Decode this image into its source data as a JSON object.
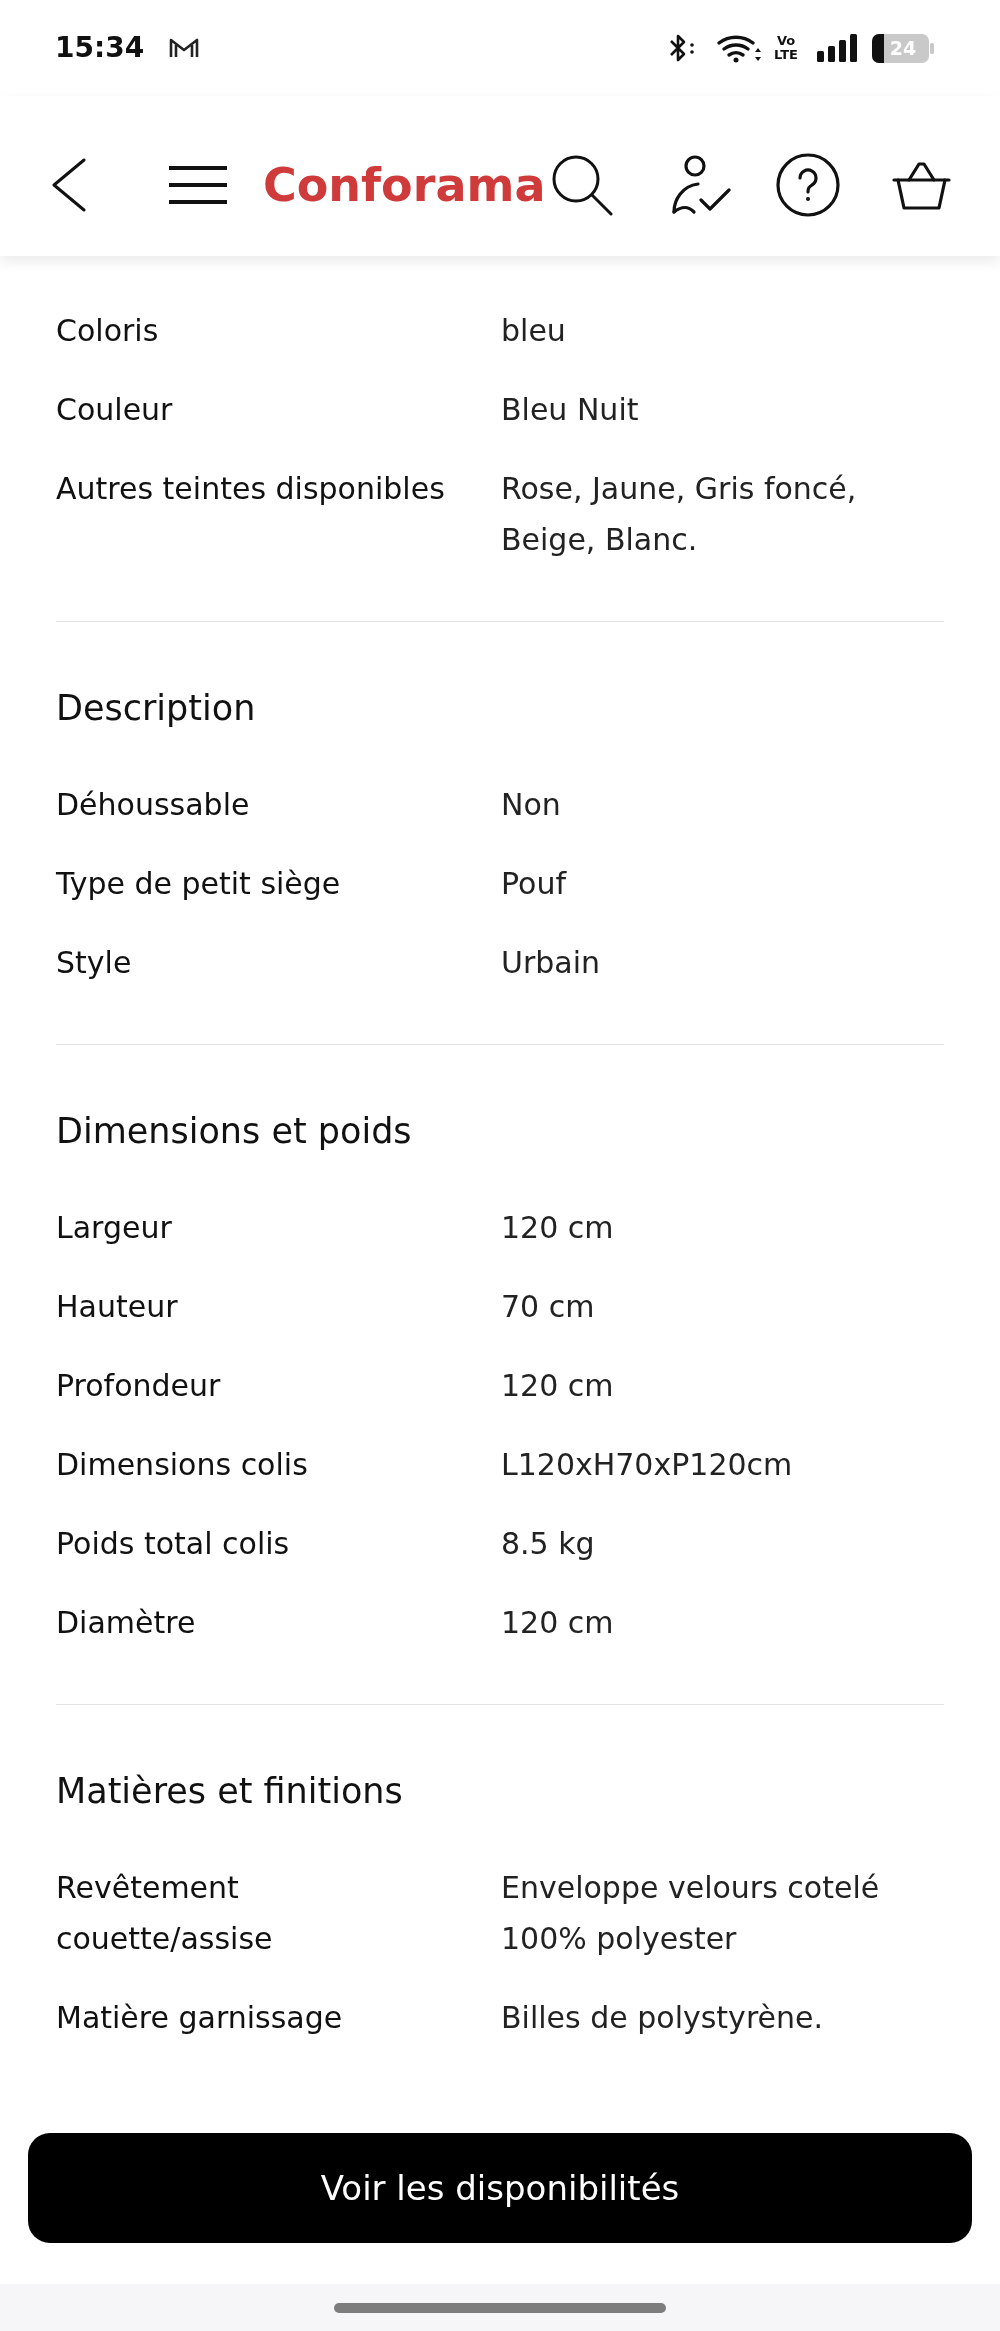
{
  "status_bar": {
    "time": "15:34",
    "network_label": [
      "Vo",
      "LTE"
    ],
    "battery": "24"
  },
  "header": {
    "logo": "Conforama"
  },
  "sections": [
    {
      "rows": [
        {
          "label": "Coloris",
          "value": "bleu"
        },
        {
          "label": "Couleur",
          "value": "Bleu Nuit"
        },
        {
          "label": "Autres teintes disponibles",
          "value": "Rose, Jaune, Gris foncé, Beige, Blanc."
        }
      ]
    },
    {
      "title": "Description",
      "rows": [
        {
          "label": "Déhoussable",
          "value": "Non"
        },
        {
          "label": "Type de petit siège",
          "value": "Pouf"
        },
        {
          "label": "Style",
          "value": "Urbain"
        }
      ]
    },
    {
      "title": "Dimensions et poids",
      "rows": [
        {
          "label": "Largeur",
          "value": "120 cm"
        },
        {
          "label": "Hauteur",
          "value": "70 cm"
        },
        {
          "label": "Profondeur",
          "value": "120 cm"
        },
        {
          "label": "Dimensions colis",
          "value": "L120xH70xP120cm"
        },
        {
          "label": "Poids total colis",
          "value": "8.5 kg"
        },
        {
          "label": "Diamètre",
          "value": "120 cm"
        }
      ]
    },
    {
      "title": "Matières et finitions",
      "rows": [
        {
          "label": "Revêtement couette/assise",
          "value": "Enveloppe velours cotelé 100% polyester"
        },
        {
          "label": "Matière garnissage",
          "value": "Billes de polystyrène."
        }
      ]
    }
  ],
  "footer": {
    "button": "Voir les disponibilités"
  }
}
